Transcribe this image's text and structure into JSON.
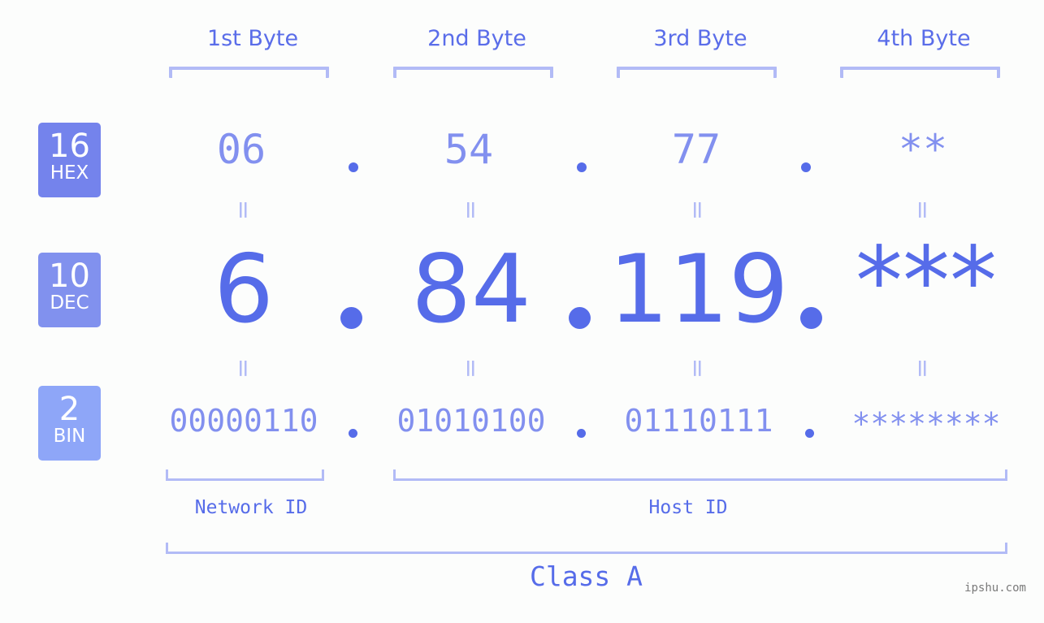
{
  "byte_headers": [
    "1st Byte",
    "2nd Byte",
    "3rd Byte",
    "4th Byte"
  ],
  "badges": {
    "hex": {
      "number": "16",
      "label": "HEX",
      "color": "#7483ec"
    },
    "dec": {
      "number": "10",
      "label": "DEC",
      "color": "#8191ee"
    },
    "bin": {
      "number": "2",
      "label": "BIN",
      "color": "#8ea6f8"
    }
  },
  "hex_values": [
    "06",
    "54",
    "77",
    "**"
  ],
  "dec_values": [
    "6",
    "84",
    "119",
    "***"
  ],
  "bin_values": [
    "00000110",
    "01010100",
    "01110111",
    "********"
  ],
  "equals_sign": "=",
  "network_id_label": "Network ID",
  "host_id_label": "Host ID",
  "class_label": "Class A",
  "watermark": "ipshu.com",
  "colors": {
    "accent": "#566ce9",
    "light_accent": "#8290ef",
    "bracket": "#b2bbf6",
    "background": "#fcfdfc"
  }
}
